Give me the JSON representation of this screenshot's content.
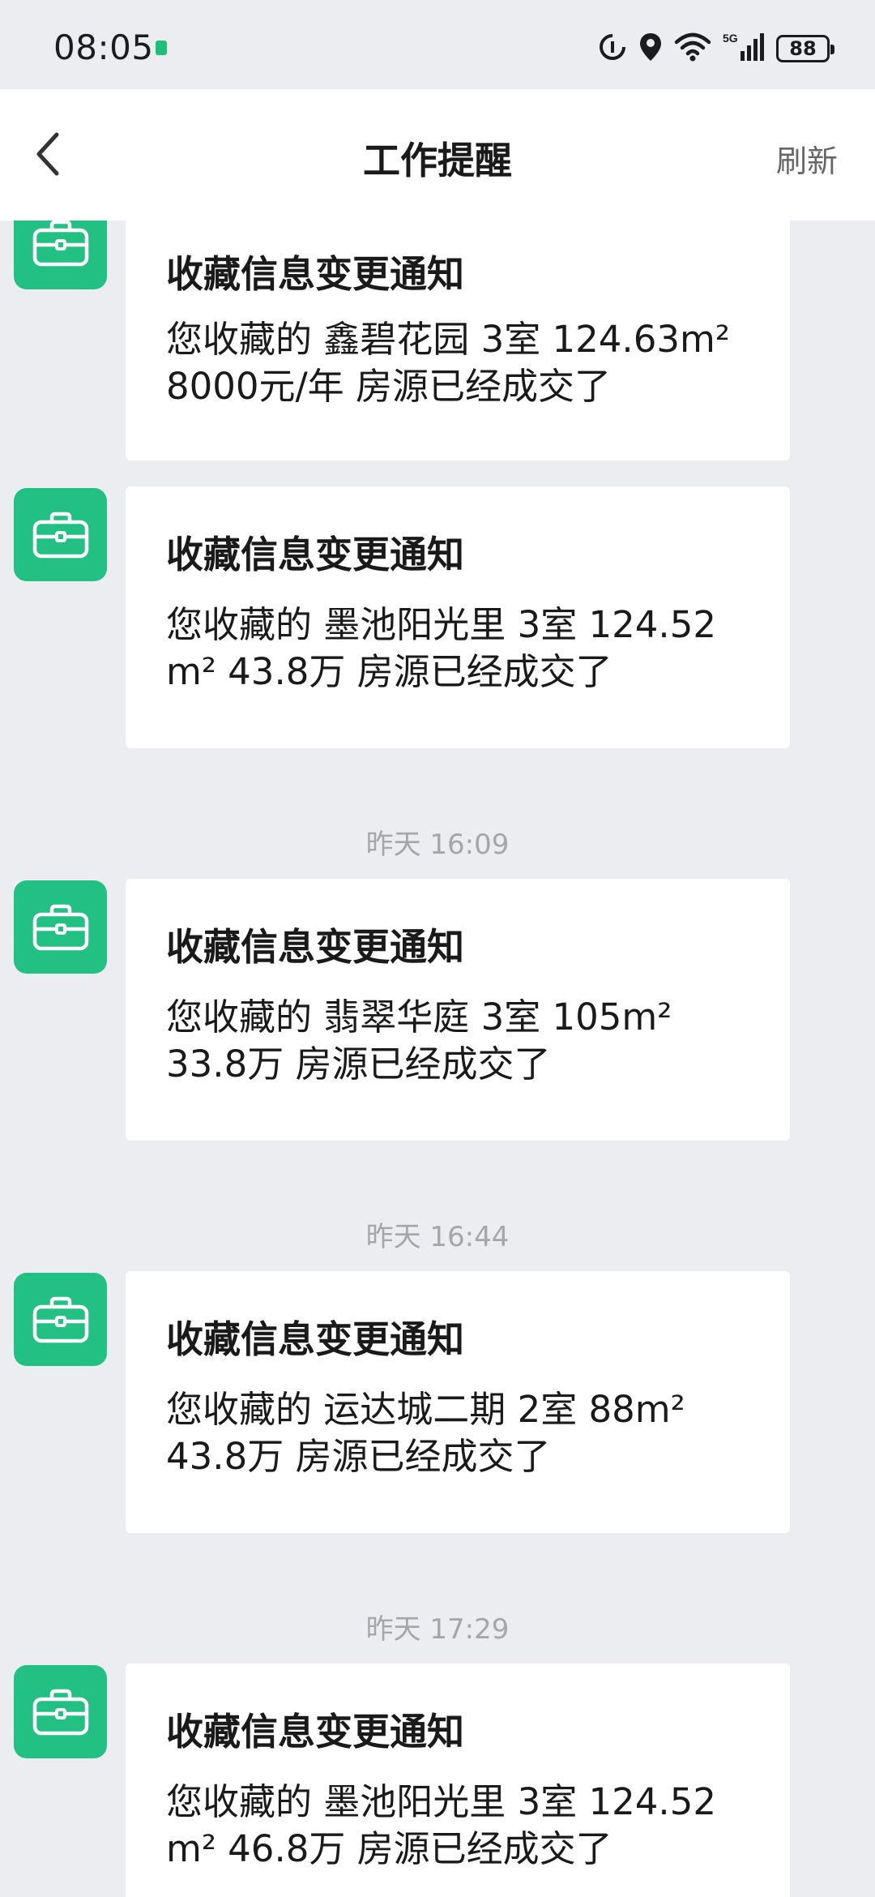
{
  "status_bar": {
    "time": "08:05",
    "battery": "88",
    "network": "5G",
    "icons": [
      "notification-icon",
      "data-saver-icon",
      "location-icon",
      "wifi-icon",
      "cellular-signal-icon",
      "battery-icon"
    ]
  },
  "header": {
    "title": "工作提醒",
    "refresh_label": "刷新",
    "back_icon": "chevron-left-icon"
  },
  "colors": {
    "accent": "#22c083",
    "background": "#ebedf0",
    "card": "#ffffff",
    "timestamp": "#a6a6a6"
  },
  "messages": [
    {
      "title": "收藏信息变更通知",
      "line1": "您收藏的 鑫碧花园 3室 124.63m²",
      "line2": "8000元/年 房源已经成交了",
      "icon": "briefcase-icon"
    },
    {
      "title": "收藏信息变更通知",
      "line1": "您收藏的 墨池阳光里 3室 124.52",
      "line2": "m² 43.8万 房源已经成交了",
      "icon": "briefcase-icon"
    },
    {
      "timestamp": "昨天 16:09",
      "title": "收藏信息变更通知",
      "line1": "您收藏的 翡翠华庭 3室 105m²",
      "line2": "33.8万 房源已经成交了",
      "icon": "briefcase-icon"
    },
    {
      "timestamp": "昨天 16:44",
      "title": "收藏信息变更通知",
      "line1": "您收藏的 运达城二期 2室 88m²",
      "line2": "43.8万 房源已经成交了",
      "icon": "briefcase-icon"
    },
    {
      "timestamp": "昨天 17:29",
      "title": "收藏信息变更通知",
      "line1": "您收藏的 墨池阳光里 3室 124.52",
      "line2": "m² 46.8万 房源已经成交了",
      "icon": "briefcase-icon"
    }
  ]
}
